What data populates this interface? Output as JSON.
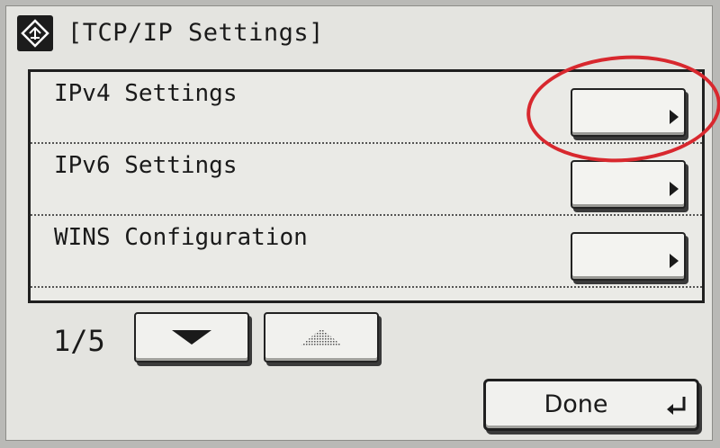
{
  "screen": {
    "title": "[TCP/IP Settings]"
  },
  "list": {
    "items": [
      {
        "label": "IPv4 Settings"
      },
      {
        "label": "IPv6 Settings"
      },
      {
        "label": "WINS Configuration"
      }
    ]
  },
  "pager": {
    "indicator": "1/5"
  },
  "footer": {
    "done_label": "Done"
  },
  "colors": {
    "highlight_ring": "#d8282e",
    "screen_bg": "#e4e4e0"
  },
  "icons": {
    "title": "home-icon",
    "row_button": "play-arrow-icon",
    "next_page": "arrow-down-icon",
    "prev_page": "arrow-up-icon",
    "done": "enter-return-icon"
  }
}
